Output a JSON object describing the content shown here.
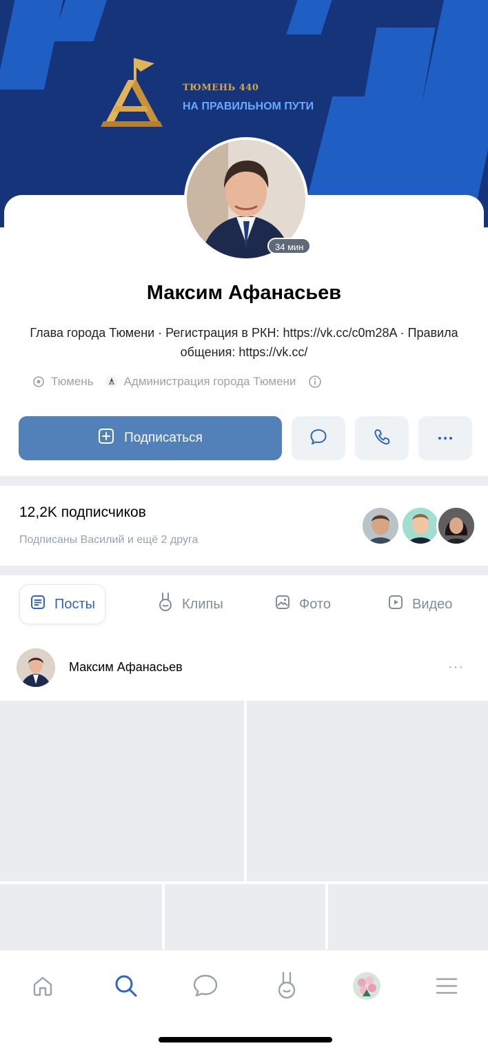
{
  "cover": {
    "year_label": "ТЮМЕНЬ 440",
    "slogan": "НА ПРАВИЛЬНОМ ПУТИ",
    "colors": {
      "background": "#15347a",
      "accent": "#1f5fc4",
      "logo": "#d6a64a",
      "slogan": "#6aa8ff"
    }
  },
  "profile": {
    "online_badge": "34 мин",
    "name": "Максим Афанасьев",
    "status": "Глава города Тюмени · Регистрация в РКН: https://vk.cc/c0m28A · Правила общения: https://vk.cc/",
    "city": "Тюмень",
    "organization": "Администрация города Тюмени",
    "subscribe_label": "Подписаться",
    "icons": {
      "city": "location-icon",
      "organization": "org-logo-icon",
      "info": "info-icon",
      "message": "message-icon",
      "call": "phone-icon",
      "more": "more-icon"
    }
  },
  "subscribers": {
    "count_label": "12,2K подписчиков",
    "friends_label": "Подписаны Василий и ещё 2 друга"
  },
  "tabs": [
    {
      "label": "Посты",
      "icon": "posts-icon",
      "active": true
    },
    {
      "label": "Клипы",
      "icon": "clips-icon",
      "active": false
    },
    {
      "label": "Фото",
      "icon": "photo-icon",
      "active": false
    },
    {
      "label": "Видео",
      "icon": "video-icon",
      "active": false
    }
  ],
  "post": {
    "author": "Максим Афанасьев",
    "more": "···"
  },
  "nav": [
    "home-icon",
    "search-icon",
    "messages-icon",
    "clips-icon",
    "profile-avatar",
    "menu-icon"
  ],
  "colors": {
    "primary_button": "#5181b8",
    "active_tab": "#2d64c8",
    "secondary_text": "#99a2ad",
    "nav_active": "#2d64c8"
  }
}
